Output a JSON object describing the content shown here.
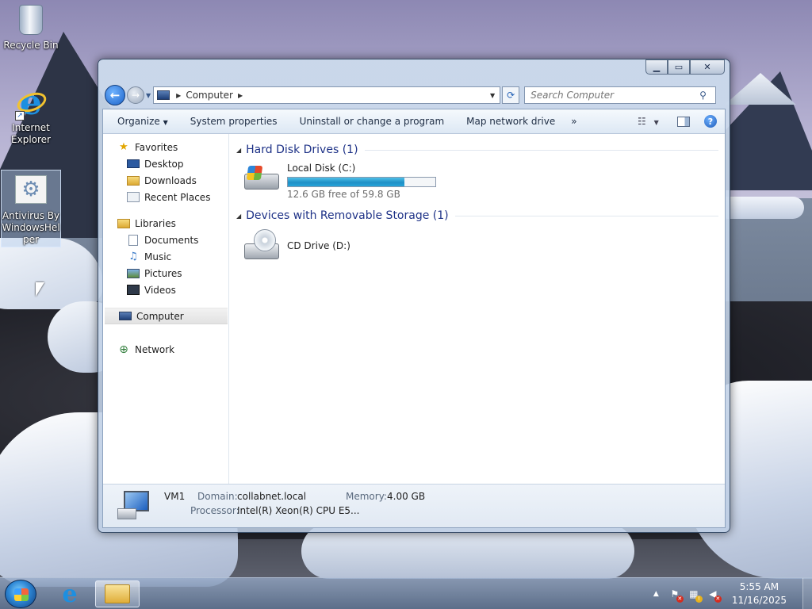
{
  "desktop": {
    "icons": [
      {
        "label": "Recycle Bin",
        "icon": "recycle-bin-icon"
      },
      {
        "label": "Internet Explorer",
        "icon": "internet-explorer-icon"
      },
      {
        "label": "Antivirus By WindowsHelper",
        "icon": "antivirus-settings-icon"
      }
    ]
  },
  "window": {
    "address": {
      "location": "Computer"
    },
    "search": {
      "placeholder": "Search Computer"
    },
    "toolbar": {
      "organize": "Organize",
      "system_properties": "System properties",
      "uninstall": "Uninstall or change a program",
      "map_drive": "Map network drive",
      "more": "»"
    },
    "nav": {
      "favorites": {
        "label": "Favorites",
        "items": [
          "Desktop",
          "Downloads",
          "Recent Places"
        ]
      },
      "libraries": {
        "label": "Libraries",
        "items": [
          "Documents",
          "Music",
          "Pictures",
          "Videos"
        ]
      },
      "computer": "Computer",
      "network": "Network"
    },
    "groups": {
      "hdd": {
        "title": "Hard Disk Drives (1)"
      },
      "removable": {
        "title": "Devices with Removable Storage (1)"
      }
    },
    "drives": {
      "c": {
        "name": "Local Disk (C:)",
        "free": "12.6 GB free of 59.8 GB",
        "used_fraction": 0.79
      },
      "d": {
        "name": "CD Drive (D:)"
      }
    },
    "details": {
      "name": "VM1",
      "domain_label": "Domain:",
      "domain": "collabnet.local",
      "memory_label": "Memory:",
      "memory": "4.00 GB",
      "processor_label": "Processor:",
      "processor": "Intel(R) Xeon(R) CPU E5..."
    }
  },
  "taskbar": {
    "clock": {
      "time": "5:55 AM",
      "date": "11/16/2025"
    },
    "tray_expand": "▲"
  },
  "colors": {
    "group_title": "#1e3287",
    "progress": "#26a3d8"
  }
}
